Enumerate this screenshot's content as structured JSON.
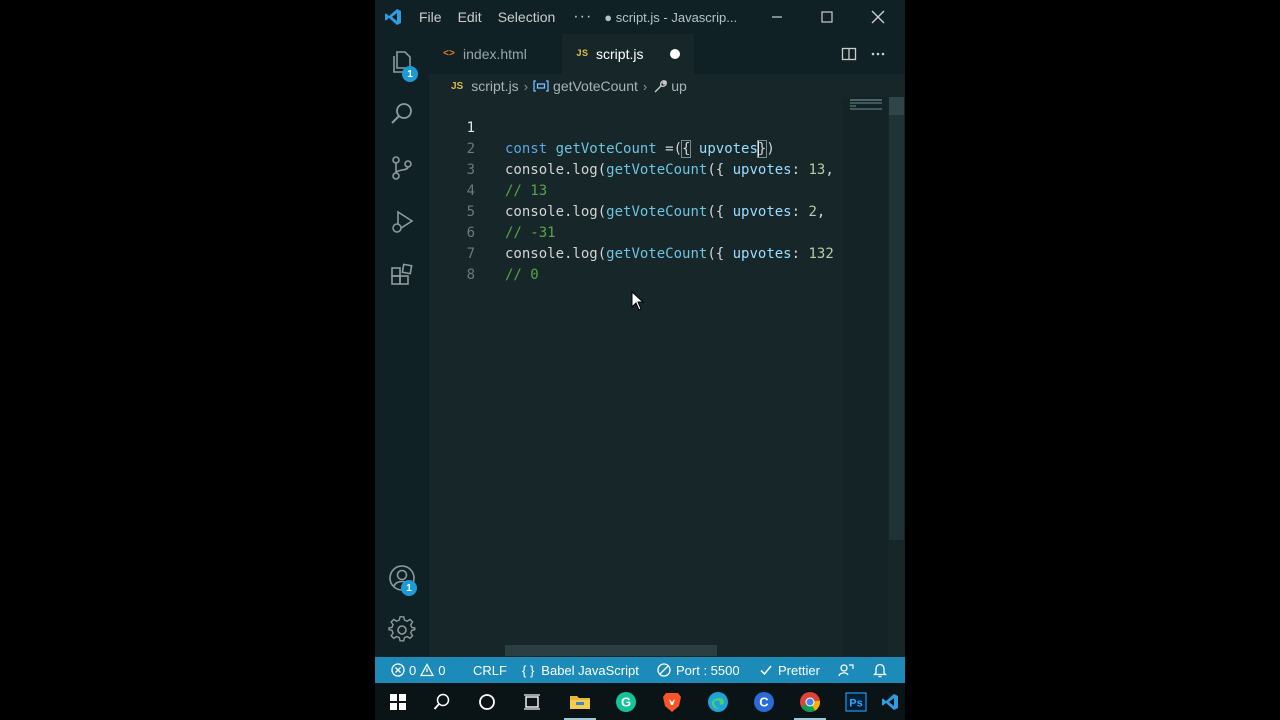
{
  "titlebar": {
    "menus": [
      "File",
      "Edit",
      "Selection",
      "···"
    ],
    "title": "● script.js - Javascrip..."
  },
  "activity_bar": {
    "explorer_badge": "1",
    "accounts_badge": "1"
  },
  "tabs": [
    {
      "icon": "<>",
      "label": "index.html",
      "active": false
    },
    {
      "icon": "JS",
      "label": "script.js",
      "active": true,
      "dirty": true
    }
  ],
  "breadcrumb": {
    "file_icon": "JS",
    "file": "script.js",
    "symbol": "getVoteCount",
    "symbol2": "up"
  },
  "editor": {
    "line_numbers": [
      "1",
      "2",
      "3",
      "4",
      "5",
      "6",
      "7",
      "8"
    ],
    "lines": [
      {
        "t1": "const",
        "t2": "getVoteCount",
        "t3": " =(",
        "t4": "{",
        "t5": " upvotes",
        "t6": "}",
        "t7": ")"
      },
      {
        "t1": "console.log(",
        "t2": "getVoteCount",
        "t3": "({ ",
        "t4": "upvotes",
        "t5": ": ",
        "t6": "13",
        "t7": ","
      },
      {
        "t1": "// 13"
      },
      {
        "t1": "console.log(",
        "t2": "getVoteCount",
        "t3": "({ ",
        "t4": "upvotes",
        "t5": ": ",
        "t6": "2",
        "t7": ","
      },
      {
        "t1": "// -31"
      },
      {
        "t1": "console.log(",
        "t2": "getVoteCount",
        "t3": "({ ",
        "t4": "upvotes",
        "t5": ": ",
        "t6": "132",
        "t7": ""
      },
      {
        "t1": "// 0"
      },
      {
        "t1": ""
      }
    ]
  },
  "statusbar": {
    "errors": "0",
    "warnings": "0",
    "eol": "CRLF",
    "language": "Babel JavaScript",
    "port": "Port : 5500",
    "formatter": "Prettier"
  },
  "colors": {
    "statusbar": "#1c8bb9",
    "editor_bg": "#162629",
    "chrome_bg": "#0f2124",
    "badge": "#1b9bd7"
  },
  "taskbar_icons": [
    "windows-start-icon",
    "search-icon",
    "cortana-icon",
    "task-view-icon",
    "file-explorer-icon",
    "grammarly-icon",
    "brave-icon",
    "edge-icon",
    "ccleaner-icon",
    "chrome-icon",
    "photoshop-icon",
    "vscode-icon"
  ],
  "taskbar_labels": {
    "photoshop": "Ps",
    "ccleaner": "C",
    "grammarly": "G"
  }
}
